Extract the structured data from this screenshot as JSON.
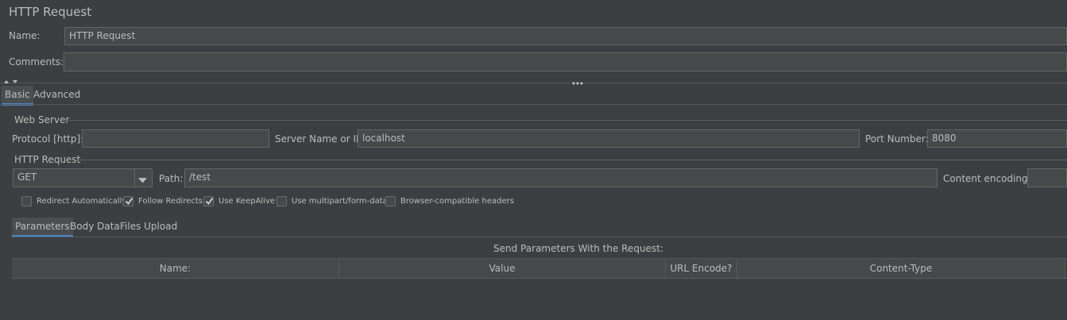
{
  "title": "HTTP Request",
  "name": {
    "label": "Name:",
    "value": "HTTP Request"
  },
  "comments": {
    "label": "Comments:",
    "value": ""
  },
  "tabs": [
    {
      "label": "Basic"
    },
    {
      "label": "Advanced"
    }
  ],
  "web_server": {
    "legend": "Web Server",
    "protocol_label": "Protocol [http]:",
    "protocol_value": "",
    "server_label": "Server Name or IP:",
    "server_value": "localhost",
    "port_label": "Port Number:",
    "port_value": "8080"
  },
  "http_request": {
    "legend": "HTTP Request",
    "method": "GET",
    "path_label": "Path:",
    "path_value": "/test",
    "encoding_label": "Content encoding:",
    "encoding_value": ""
  },
  "options": [
    {
      "label": "Redirect Automatically",
      "checked": false
    },
    {
      "label": "Follow Redirects",
      "checked": true
    },
    {
      "label": "Use KeepAlive",
      "checked": true
    },
    {
      "label": "Use multipart/form-data",
      "checked": false
    },
    {
      "label": "Browser-compatible headers",
      "checked": false
    }
  ],
  "sub_tabs": [
    {
      "label": "Parameters"
    },
    {
      "label": "Body Data"
    },
    {
      "label": "Files Upload"
    }
  ],
  "params": {
    "caption": "Send Parameters With the Request:",
    "columns": [
      "Name:",
      "Value",
      "URL Encode?",
      "Content-Type"
    ]
  },
  "icons": {
    "dropdown": "chevron-down-icon",
    "checkbox": "check-icon",
    "splitter": "more-dots-icon"
  },
  "colors": {
    "background": "#3c3f41",
    "accent": "#4a88c7",
    "field": "#45494a"
  }
}
